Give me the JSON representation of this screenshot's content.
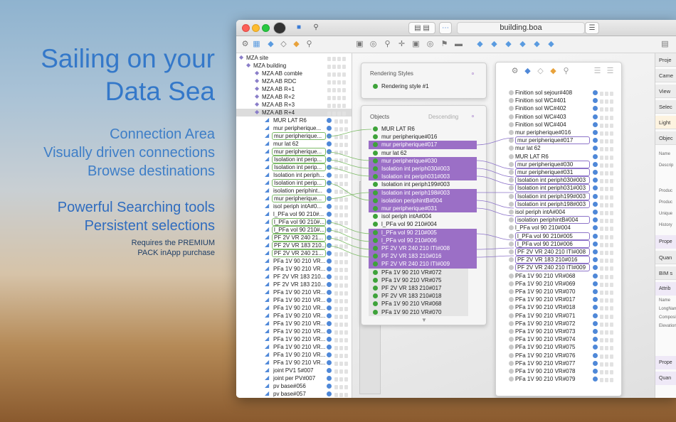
{
  "marketing": {
    "headline_line1": "Sailing on your",
    "headline_line2": "Data Sea",
    "features": [
      "Connection Area",
      "Visually driven connections",
      "Browse destinations"
    ],
    "features2": [
      "Powerful Searching tools",
      "Persistent selections"
    ],
    "premium_line1": "Requires the PREMIUM",
    "premium_line2": "PACK inApp purchase"
  },
  "window": {
    "title": "building.boa"
  },
  "tree": {
    "items": [
      {
        "label": "MZA site",
        "level": 0
      },
      {
        "label": "MZA building",
        "level": 1
      },
      {
        "label": "MZA AB comble",
        "level": 2
      },
      {
        "label": "MZA AB RDC",
        "level": 2
      },
      {
        "label": "MZA AB R+1",
        "level": 2
      },
      {
        "label": "MZA AB R+2",
        "level": 2
      },
      {
        "label": "MZA AB R+3",
        "level": 2
      },
      {
        "label": "MZA AB R+4",
        "level": 2
      },
      {
        "label": "MUR LAT R6",
        "level": 3
      },
      {
        "label": "mur peripherique...",
        "level": 3
      },
      {
        "label": "mur peripherique...",
        "level": 3
      },
      {
        "label": "mur lat 62",
        "level": 3
      },
      {
        "label": "mur peripherique...",
        "level": 3
      },
      {
        "label": "Isolation int perip...",
        "level": 3
      },
      {
        "label": "Isolation int perip...",
        "level": 3
      },
      {
        "label": "Isolation int periph...",
        "level": 3
      },
      {
        "label": "Isolation int perip...",
        "level": 3
      },
      {
        "label": "isolation periphint...",
        "level": 3
      },
      {
        "label": "mur peripherique...",
        "level": 3
      },
      {
        "label": "isol periph intA#0...",
        "level": 3
      },
      {
        "label": "l_PFa vol 90 210#...",
        "level": 3
      },
      {
        "label": "l_PFa vol 90 210#...",
        "level": 3
      },
      {
        "label": "l_PFa vol 90 210#...",
        "level": 3
      },
      {
        "label": "PF 2V VR  240 21...",
        "level": 3
      },
      {
        "label": "PF 2V VR 183 210...",
        "level": 3
      },
      {
        "label": "PF 2V VR  240 21...",
        "level": 3
      },
      {
        "label": "PFa 1V 90 210 VR...",
        "level": 3
      },
      {
        "label": "PFa 1V 90 210 VR...",
        "level": 3
      },
      {
        "label": "PF 2V VR 183 210...",
        "level": 3
      },
      {
        "label": "PF 2V VR 183 210...",
        "level": 3
      },
      {
        "label": "PFa 1V 90 210 VR...",
        "level": 3
      },
      {
        "label": "PFa 1V 90 210 VR...",
        "level": 3
      },
      {
        "label": "PFa 1V 90 210 VR...",
        "level": 3
      },
      {
        "label": "PFa 1V 90 210 VR...",
        "level": 3
      },
      {
        "label": "PFa 1V 90 210 VR...",
        "level": 3
      },
      {
        "label": "PFa 1V 90 210 VR...",
        "level": 3
      },
      {
        "label": "PFa 1V 90 210 VR...",
        "level": 3
      },
      {
        "label": "PFa 1V 90 210 VR...",
        "level": 3
      },
      {
        "label": "PFa 1V 90 210 VR...",
        "level": 3
      },
      {
        "label": "PFa 1V 90 210 VR...",
        "level": 3
      },
      {
        "label": "joint PV1 5#007",
        "level": 3
      },
      {
        "label": "joint per PV#007",
        "level": 3
      },
      {
        "label": "pv base#056",
        "level": 3
      },
      {
        "label": "pv base#057",
        "level": 3
      }
    ]
  },
  "rendering_styles": {
    "title": "Rendering Styles",
    "item": "Rendering style #1"
  },
  "objects": {
    "title": "Objects",
    "sort": "Descending",
    "items": [
      "MUR LAT R6",
      "mur peripherique#016",
      "mur peripherique#017",
      "mur lat 62",
      "mur peripherique#030",
      "Isolation int periph030#003",
      "Isolation int periph031#003",
      "Isolation int periph199#003",
      "Isolation int periph198#003",
      "isolation periphintB#004",
      "mur peripherique#031",
      "isol periph intA#004",
      "l_PFa vol 90 210#004",
      "l_PFa vol 90 210#005",
      "l_PFa vol 90 210#006",
      "PF 2V VR  240 210 ITI#008",
      "PF 2V VR 183 210#016",
      "PF 2V VR  240 210 ITI#009",
      "PFa 1V 90 210 VR#072",
      "PFa 1V 90 210 VR#075",
      "PF 2V VR 183 210#017",
      "PF 2V VR 183 210#018",
      "PFa 1V 90 210 VR#068",
      "PFa 1V 90 210 VR#070"
    ]
  },
  "destinations": {
    "items": [
      "Finition sol sejour#408",
      "Finition sol WC#401",
      "Finition sol WC#402",
      "Finition sol WC#403",
      "Finition sol WC#404",
      "mur peripherique#016",
      "mur peripherique#017",
      "mur lat 62",
      "MUR LAT R6",
      "mur peripherique#030",
      "mur peripherique#031",
      "Isolation int periph030#003",
      "Isolation int periph031#003",
      "Isolation int periph199#003",
      "Isolation int periph198#003",
      "isol periph intA#004",
      "isolation periphintB#004",
      "l_PFa vol 90 210#004",
      "l_PFa vol 90 210#005",
      "l_PFa vol 90 210#006",
      "PF 2V VR  240 210 ITI#008",
      "PF 2V VR 183 210#016",
      "PF 2V VR  240 210 ITI#009",
      "PFa 1V 90 210 VR#068",
      "PFa 1V 90 210 VR#069",
      "PFa 1V 90 210 VR#070",
      "PFa 1V 90 210 VR#017",
      "PFa 1V 90 210 VR#018",
      "PFa 1V 90 210 VR#071",
      "PFa 1V 90 210 VR#072",
      "PFa 1V 90 210 VR#073",
      "PFa 1V 90 210 VR#074",
      "PFa 1V 90 210 VR#075",
      "PFa 1V 90 210 VR#076",
      "PFa 1V 90 210 VR#077",
      "PFa 1V 90 210 VR#078",
      "PFa 1V 90 210 VR#079"
    ]
  },
  "inspector": {
    "rows": [
      "Proje",
      "Came",
      "View",
      "Selec",
      "Light",
      "Objec",
      "Name",
      "Descrip",
      "Produc",
      "Produc",
      "Unique",
      "History",
      "Prope",
      "Quan",
      "BIM s",
      "Attrib",
      "Name",
      "LongNam",
      "Composi",
      "Elevation",
      "Prope",
      "Quan"
    ]
  },
  "colors": {
    "accent": "#3478c9",
    "highlight": "#9b6fc6",
    "ok_dot": "#3ea33a"
  }
}
